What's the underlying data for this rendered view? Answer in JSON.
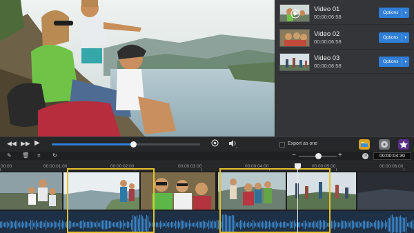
{
  "playlist": {
    "items": [
      {
        "title": "Video 01",
        "duration": "00:00:06:58",
        "options_label": "Options"
      },
      {
        "title": "Video 02",
        "duration": "00:00:06:58",
        "options_label": "Options"
      },
      {
        "title": "Video 03",
        "duration": "00:00:06:58",
        "options_label": "Options"
      }
    ]
  },
  "player": {
    "seek_progress": 0.55,
    "export_label": "Export as one"
  },
  "toolbar": {
    "zoom_minus": "−",
    "zoom_plus": "+",
    "zoom_level": 0.5,
    "time_value": "00:00:04:30"
  },
  "ruler": {
    "ticks": [
      "00:00",
      "00:00:01:00",
      "00:00:02:00",
      "00:00:03:00",
      "00:00:04:00",
      "00:00:05:00",
      "00:00:06:00"
    ]
  },
  "colors": {
    "accent": "#2f7fd8",
    "selection": "#e7c12b",
    "waveform": "#3a86c8"
  },
  "icons": {
    "rewind": "rewind-icon",
    "fast_forward": "fast-forward-icon",
    "play": "play-icon",
    "snapshot": "snapshot-icon",
    "volume": "volume-icon",
    "folder": "folder-icon",
    "burn": "burn-disc-icon",
    "star": "star-icon",
    "edit": "edit-icon",
    "delete": "delete-icon",
    "crop": "crop-icon",
    "rotate": "rotate-icon",
    "clock": "clock-icon"
  }
}
